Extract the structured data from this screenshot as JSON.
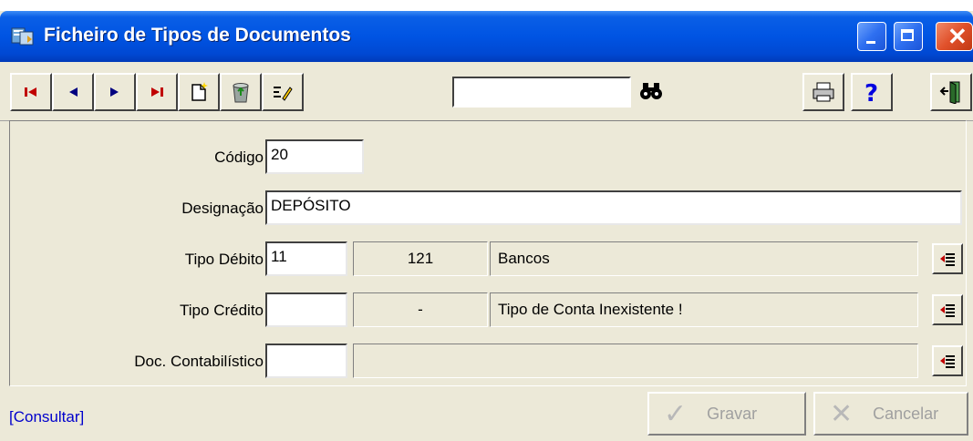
{
  "window": {
    "title": "Ficheiro de Tipos de Documentos"
  },
  "toolbar": {
    "search_value": ""
  },
  "form": {
    "codigo": {
      "label": "Código",
      "value": "20"
    },
    "designacao": {
      "label": "Designação",
      "value": "DEPÓSITO"
    },
    "tipo_debito": {
      "label": "Tipo Débito",
      "code": "11",
      "account": "121",
      "description": "Bancos"
    },
    "tipo_credito": {
      "label": "Tipo Crédito",
      "code": "",
      "account": "-",
      "description": "Tipo de Conta Inexistente !"
    },
    "doc_contabilistico": {
      "label": "Doc. Contabilístico",
      "code": "",
      "description": ""
    }
  },
  "footer": {
    "status": "[Consultar]",
    "save_label": "Gravar",
    "cancel_label": "Cancelar"
  },
  "colors": {
    "titlebar": "#0054e3",
    "face": "#ece9d8",
    "status_link": "#0000cc",
    "disabled_text": "#a0a0a0"
  }
}
